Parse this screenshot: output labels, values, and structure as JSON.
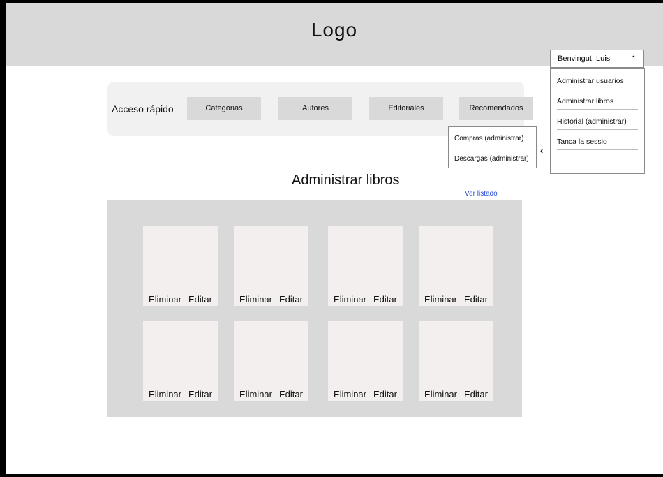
{
  "header": {
    "logo": "Logo"
  },
  "account": {
    "greeting": "Benvingut, Luis",
    "menu": [
      "Administrar usuarios",
      "Administrar libros",
      "Historial (administrar)",
      "Tanca la sessio"
    ]
  },
  "quick_access": {
    "label": "Acceso rápido",
    "buttons": [
      "Categorias",
      "Autores",
      "Editoriales",
      "Recomendados"
    ],
    "submenu": [
      "Compras (administrar)",
      "Descargas (administrar)"
    ]
  },
  "main": {
    "title": "Administrar libros",
    "view_list": "Ver listado",
    "cards": [
      {
        "delete": "Eliminar",
        "edit": "Editar"
      },
      {
        "delete": "Eliminar",
        "edit": "Editar"
      },
      {
        "delete": "Eliminar",
        "edit": "Editar"
      },
      {
        "delete": "Eliminar",
        "edit": "Editar"
      },
      {
        "delete": "Eliminar",
        "edit": "Editar"
      },
      {
        "delete": "Eliminar",
        "edit": "Editar"
      },
      {
        "delete": "Eliminar",
        "edit": "Editar"
      },
      {
        "delete": "Eliminar",
        "edit": "Editar"
      }
    ]
  }
}
